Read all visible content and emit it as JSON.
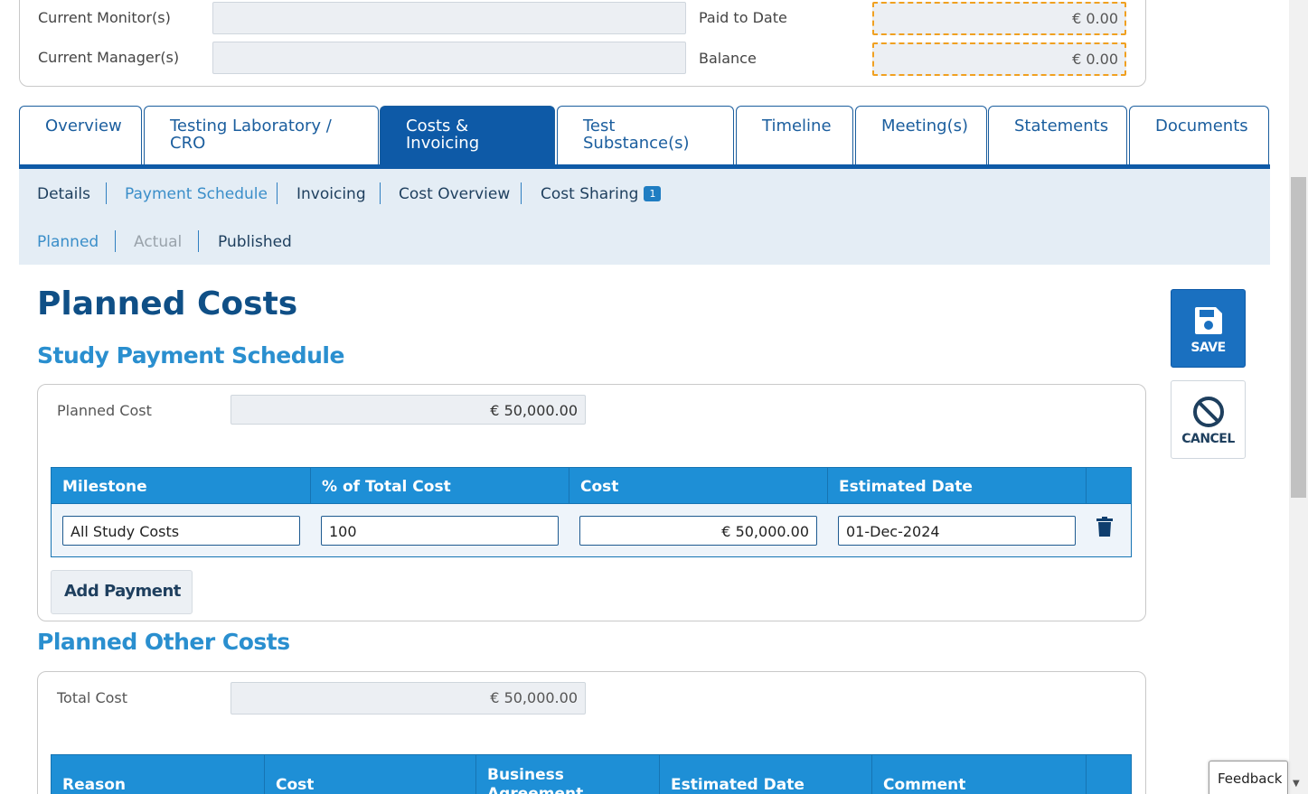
{
  "summary": {
    "monitors_label": "Current Monitor(s)",
    "monitors_value": "",
    "managers_label": "Current Manager(s)",
    "managers_value": "",
    "paid_label": "Paid to Date",
    "paid_value": "€ 0.00",
    "balance_label": "Balance",
    "balance_value": "€ 0.00"
  },
  "tabs": [
    {
      "label": "Overview",
      "active": false
    },
    {
      "label": "Testing Laboratory / CRO",
      "active": false
    },
    {
      "label": "Costs & Invoicing",
      "active": true
    },
    {
      "label": "Test Substance(s)",
      "active": false
    },
    {
      "label": "Timeline",
      "active": false
    },
    {
      "label": "Meeting(s)",
      "active": false
    },
    {
      "label": "Statements",
      "active": false
    },
    {
      "label": "Documents",
      "active": false
    }
  ],
  "subnav": {
    "details": "Details",
    "payment_schedule": "Payment Schedule",
    "invoicing": "Invoicing",
    "cost_overview": "Cost Overview",
    "cost_sharing": "Cost Sharing",
    "cost_sharing_badge": "1"
  },
  "subnav2": {
    "planned": "Planned",
    "actual": "Actual",
    "published": "Published"
  },
  "page_title": "Planned Costs",
  "payment_schedule": {
    "title": "Study Payment Schedule",
    "planned_cost_label": "Planned Cost",
    "planned_cost_value": "€ 50,000.00",
    "columns": [
      "Milestone",
      "% of Total Cost",
      "Cost",
      "Estimated Date"
    ],
    "rows": [
      {
        "milestone": "All Study Costs",
        "percent": "100",
        "cost": "€ 50,000.00",
        "date": "01-Dec-2024"
      }
    ],
    "add_button": "Add Payment"
  },
  "other_costs": {
    "title": "Planned Other Costs",
    "total_cost_label": "Total Cost",
    "total_cost_value": "€ 50,000.00",
    "columns": [
      "Reason",
      "Cost",
      "Business Agreement",
      "Estimated Date",
      "Comment"
    ]
  },
  "actions": {
    "save": "SAVE",
    "cancel": "CANCEL"
  },
  "feedback": "Feedback",
  "colors": {
    "primary": "#0e5aa7",
    "accent": "#1e8fd6",
    "warning_border": "#f0a020"
  }
}
